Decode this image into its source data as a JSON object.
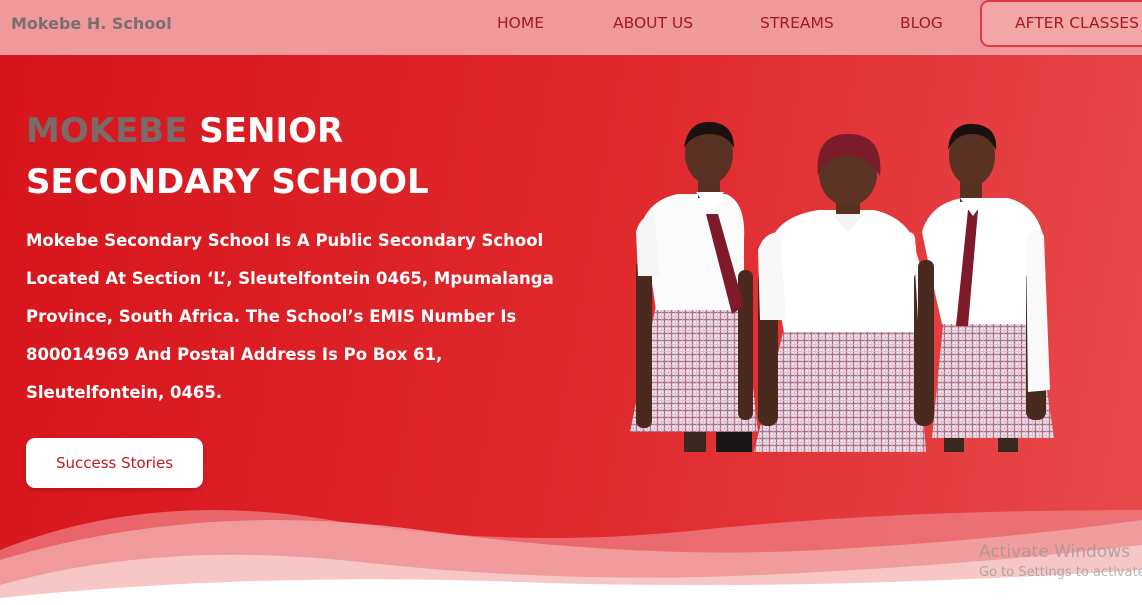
{
  "navbar": {
    "brand": "Mokebe H. School",
    "links": [
      "HOME",
      "ABOUT US",
      "STREAMS",
      "BLOG"
    ],
    "cta": "AFTER CLASSES"
  },
  "hero": {
    "title_accent": "MOKEBE",
    "title_rest_1": " SENIOR",
    "title_rest_2": "SECONDARY SCHOOL",
    "description": "Mokebe Secondary School Is A Public Secondary School Located At Section ‘L’, Sleutelfontein 0465, Mpumalanga Province, South Africa. The School’s EMIS Number Is 800014969 And Postal Address Is Po Box 61, Sleutelfontein, 0465.",
    "button": "Success Stories"
  },
  "watermark": {
    "line1": "Activate Windows",
    "line2": "Go to Settings to activate Windows."
  },
  "colors": {
    "hero_red": "#d7141b",
    "navbar_pink": "#f0999c",
    "nav_text": "#a31a20",
    "accent_grey": "#7a6a6a"
  }
}
